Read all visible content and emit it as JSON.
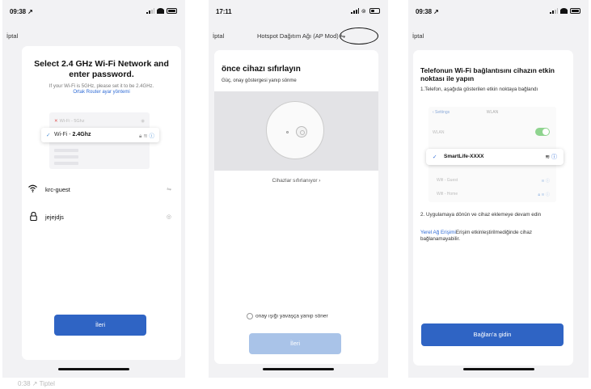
{
  "colors": {
    "accent": "#2f64c4",
    "disabled_button": "#a9c3e8",
    "link": "#2f6bd5",
    "error": "#e05050",
    "toggle_on": "#8fd48f"
  },
  "phone1": {
    "status": {
      "time": "09:38 ↗"
    },
    "nav": {
      "back": "İptal"
    },
    "title": "Select 2.4 GHz Wi-Fi Network and enter password.",
    "subtitle": "If your Wi-Fi is 5GHz, please set it to be 2.4GHz.",
    "router_link": "Ortak Router ayar yöntemi",
    "illustration": {
      "bad_network": "Wi-Fi - 5Ghz",
      "good_prefix": "Wi-Fi - ",
      "good_band": "2.4Ghz"
    },
    "network_field": {
      "value": "krc-guest",
      "icon": "wifi-icon",
      "action_icon": "switch-network-icon"
    },
    "password_field": {
      "value": "jejejdjs",
      "icon": "lock-icon",
      "action_icon": "eye-icon"
    },
    "next_button": "İleri"
  },
  "phone2": {
    "status": {
      "time": "17:11"
    },
    "nav": {
      "back": "İptal",
      "title_prefix": "Hotspot Dağıtım Ağı ",
      "title_mode": "(AP Mod)",
      "switch_icon": "⇋"
    },
    "title": "önce cihazı sıfırlayın",
    "subtitle": "Güç, onay göstergesi yanıp sönme",
    "reset_link": "Cihazlar sıfırlanıyor ›",
    "confirm_label": "onay ışığı yavaşça yanıp söner",
    "next_button": "İleri"
  },
  "phone3": {
    "status": {
      "time": "09:38 ↗"
    },
    "nav": {
      "back": "İptal"
    },
    "title": "Telefonun Wi-Fi bağlantısını cihazın etkin noktası ile yapın",
    "step1": "1.Telefon, aşağıda gösterilen etkin noktaya bağlandı",
    "illustration": {
      "back": "‹ Settings",
      "header": "WLAN",
      "wlan_label": "WLAN",
      "selected_network": "SmartLife-XXXX",
      "other_networks": [
        "Wifi - Guest",
        "Wifi - Home"
      ]
    },
    "step2": "2. Uygulamaya dönün ve cihaz eklemeye devam edin",
    "note_link": "Yerel Ağ Erişimi",
    "note_text": "Erişim etkinleştirilmediğinde cihaz bağlanamayabilir.",
    "connect_button": "Bağlan'a gidin"
  },
  "caption": "0:38 ↗ Tiptel"
}
